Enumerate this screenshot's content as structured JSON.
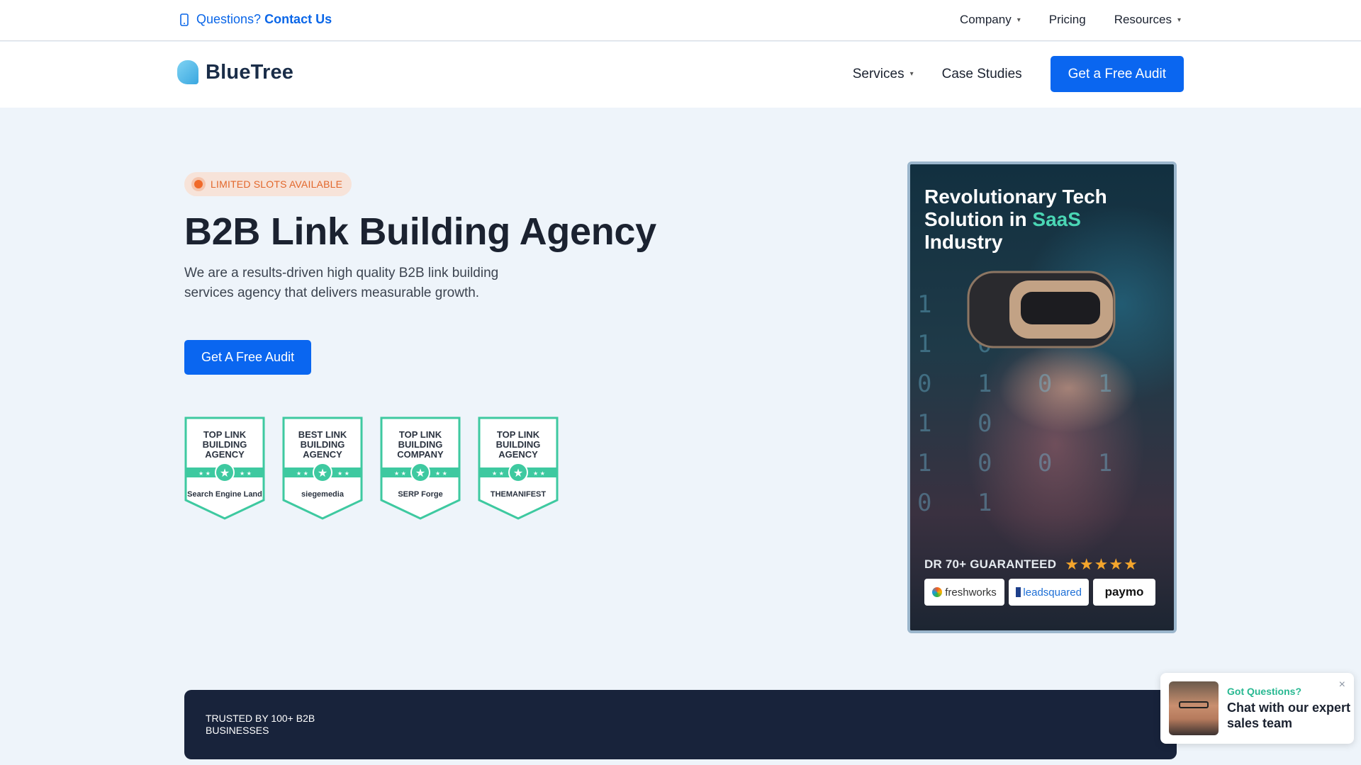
{
  "topbar": {
    "contact_prefix": "Questions?",
    "contact_link": "Contact Us",
    "nav": [
      {
        "label": "Company",
        "dropdown": true
      },
      {
        "label": "Pricing",
        "dropdown": false
      },
      {
        "label": "Resources",
        "dropdown": true
      }
    ]
  },
  "header": {
    "brand": "BlueTree",
    "nav": [
      {
        "label": "Services",
        "dropdown": true
      },
      {
        "label": "Case Studies",
        "dropdown": false
      }
    ],
    "cta": "Get a Free Audit"
  },
  "hero": {
    "badge": "LIMITED SLOTS AVAILABLE",
    "title": "B2B Link Building Agency",
    "subtitle": "We are a results-driven high quality B2B link building services agency that delivers measurable growth.",
    "cta": "Get A Free Audit",
    "awards": [
      {
        "title": "TOP LINK BUILDING AGENCY",
        "source": "Search Engine Land"
      },
      {
        "title": "BEST LINK BUILDING AGENCY",
        "source": "siegemedia"
      },
      {
        "title": "TOP LINK BUILDING COMPANY",
        "source": "SERP Forge"
      },
      {
        "title": "TOP LINK BUILDING AGENCY",
        "source": "THEMANIFEST"
      }
    ]
  },
  "case_card": {
    "title_part1": "Revolutionary Tech Solution in ",
    "title_highlight": "SaaS",
    "title_part2": "Industry",
    "guarantee": "DR 70+ GUARANTEED",
    "rating": 5,
    "stars": "★★★★★",
    "logos": [
      "freshworks",
      "leadsquared",
      "paymo"
    ],
    "highlight_color": "#4ad6b4"
  },
  "trusted": {
    "label": "TRUSTED BY 100+ B2B BUSINESSES"
  },
  "chat": {
    "question": "Got Questions?",
    "message": "Chat with our expert sales team",
    "close_icon": "×"
  },
  "colors": {
    "primary": "#0a66f0",
    "accent_green": "#27b891",
    "badge_orange": "#e2672b",
    "dark_band": "#18233b"
  },
  "icons": {
    "phone": "phone-icon",
    "caret": "chevron-down-icon",
    "close": "close-icon"
  }
}
